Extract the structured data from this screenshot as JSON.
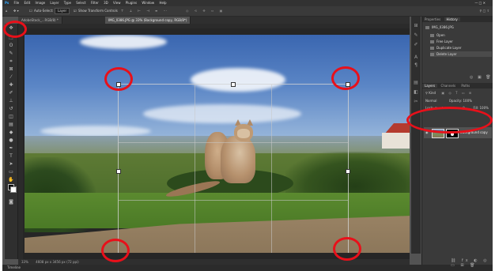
{
  "menubar": {
    "items": [
      "Ps",
      "File",
      "Edit",
      "Image",
      "Layer",
      "Type",
      "Select",
      "Filter",
      "3D",
      "View",
      "Plugins",
      "Window",
      "Help"
    ],
    "window_controls": "— □ ✕"
  },
  "options": {
    "auto_select_label": "Auto-Select:",
    "auto_select_value": "Layer",
    "show_transform_label": "Show Transform Controls"
  },
  "tabs": [
    {
      "label": "AdobeStock_...RGB/8) *",
      "active": false
    },
    {
      "label": "IMG_0386.JPG @ 33% (Background copy, RGB/8*)",
      "active": true
    }
  ],
  "status": {
    "zoom": "33%",
    "doc_info": "4608 px x 3456 px (72 ppi)"
  },
  "timeline_label": "Timeline",
  "history_panel": {
    "tabs": [
      "Properties",
      "History"
    ],
    "active_tab": "History",
    "document": "IMG_0386.JPG",
    "items": [
      "Open",
      "Free Layer",
      "Duplicate Layer",
      "Delete Layer"
    ]
  },
  "layers_panel": {
    "tabs": [
      "Layers",
      "Channels",
      "Paths"
    ],
    "active_tab": "Layers",
    "kind_label": "Kind",
    "blend_mode": "Normal",
    "opacity_label": "Opacity: 100%",
    "lock_label": "Lock:",
    "fill_label": "Fill: 100%",
    "layer_name": "Background copy"
  },
  "annotation_color": "#e8101a"
}
